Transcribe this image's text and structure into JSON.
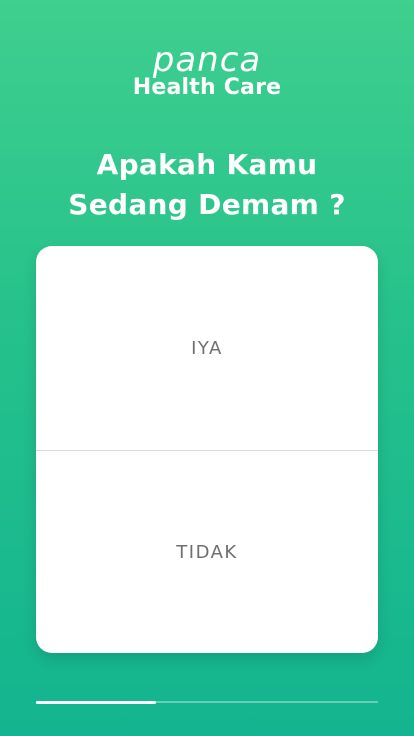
{
  "brand": {
    "logo": "panca",
    "subtitle": "Health Care"
  },
  "question": {
    "line1": "Apakah Kamu",
    "line2": "Sedang Demam ?"
  },
  "options": {
    "yes_label": "IYA",
    "no_label": "TIDAK"
  },
  "progress": {
    "fraction": 0.35
  },
  "colors": {
    "gradient_top": "#3fcf8e",
    "gradient_bottom": "#13b48f",
    "card": "#ffffff",
    "option_text": "#6f6f6f"
  }
}
